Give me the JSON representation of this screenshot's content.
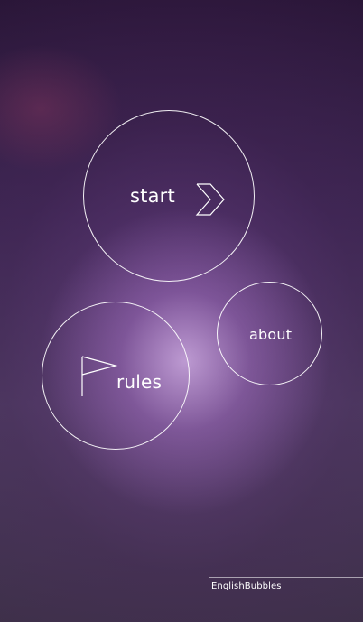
{
  "menu": {
    "start_label": "start",
    "about_label": "about",
    "rules_label": "rules"
  },
  "footer": {
    "app_name": "EnglishBubbles"
  },
  "icons": {
    "start_icon": "chevron-right-icon",
    "rules_icon": "flag-icon"
  },
  "colors": {
    "outline": "#ffffff",
    "background_top": "#2a1638",
    "background_glow": "#c9a6e0"
  }
}
